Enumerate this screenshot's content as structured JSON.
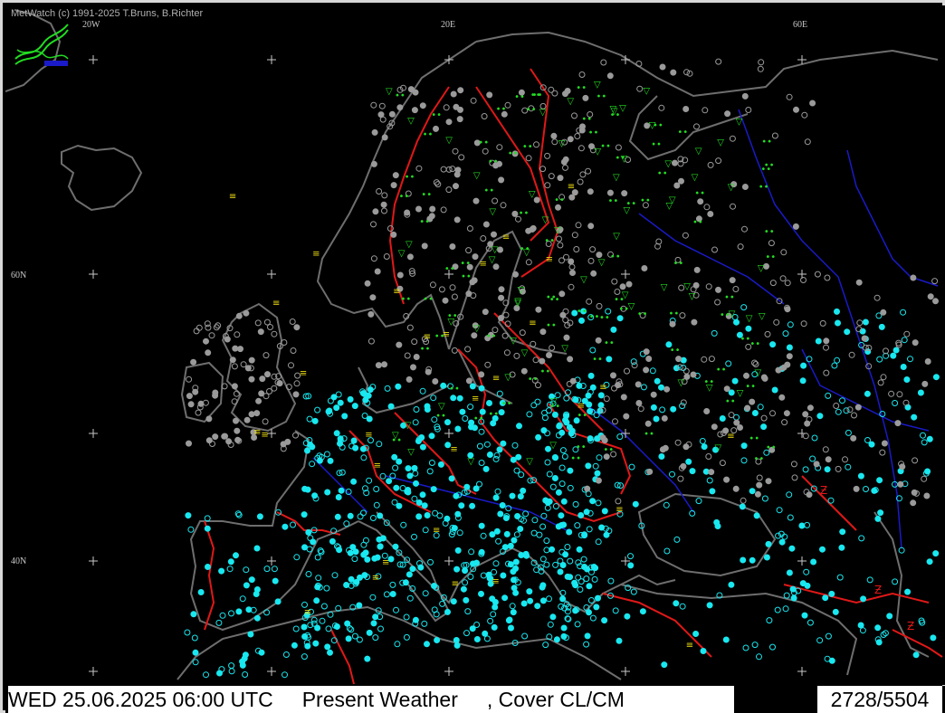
{
  "app": {
    "credit": "MetWatch  (c) 1991-2025 T.Bruns, B.Richter"
  },
  "grid_labels": [
    "20W",
    "20E",
    "60E",
    "60N",
    "40N"
  ],
  "status": {
    "left_text": "WED 25.06.2025 06:00 UTC     Present Weather     , Cover CL/CM",
    "right_text": "2728/5504"
  },
  "colors": {
    "background": "#000000",
    "coastline": "#6e6e6e",
    "borders": "#e01818",
    "rivers": "#1a1ac8",
    "station_clear": "#19e8f0",
    "station_cloudy": "#9a9a9a",
    "precip_symbol": "#22dd22",
    "fog_symbol": "#f0e010",
    "status_bar_bg": "#ffffff"
  },
  "icons": [
    "metwatch-logo-icon",
    "grid-cross-icon",
    "station-circle-icon",
    "rain-shower-icon",
    "fog-icon",
    "thunder-icon"
  ]
}
